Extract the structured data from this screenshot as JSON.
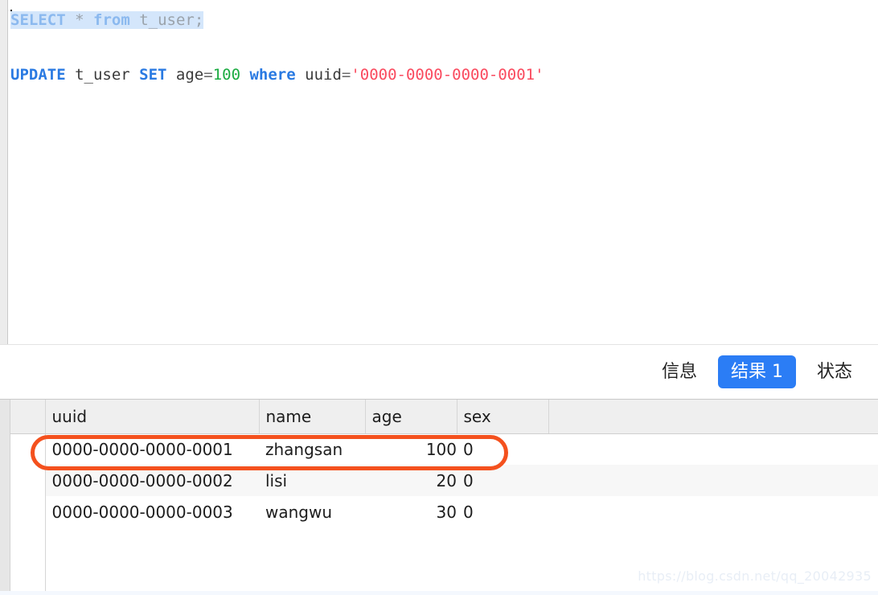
{
  "editor": {
    "lines": [
      {
        "selected": true,
        "tokens": [
          {
            "text": "SELECT",
            "type": "keyword-dim"
          },
          {
            "text": " ",
            "type": "plain-dim"
          },
          {
            "text": "*",
            "type": "operator-dim"
          },
          {
            "text": " ",
            "type": "plain-dim"
          },
          {
            "text": "from",
            "type": "keyword-dim"
          },
          {
            "text": " t_user;",
            "type": "plain-dim"
          }
        ],
        "raw": "SELECT * from t_user;"
      },
      {
        "selected": false,
        "tokens": [],
        "raw": ""
      },
      {
        "selected": false,
        "tokens": [
          {
            "text": "UPDATE",
            "type": "keyword"
          },
          {
            "text": " t_user ",
            "type": "plain"
          },
          {
            "text": "SET",
            "type": "keyword"
          },
          {
            "text": " age",
            "type": "plain"
          },
          {
            "text": "=",
            "type": "operator"
          },
          {
            "text": "100",
            "type": "number"
          },
          {
            "text": " ",
            "type": "plain"
          },
          {
            "text": "where",
            "type": "keyword"
          },
          {
            "text": " uuid",
            "type": "plain"
          },
          {
            "text": "=",
            "type": "operator"
          },
          {
            "text": "'0000-0000-0000-0001'",
            "type": "string"
          }
        ],
        "raw": "UPDATE t_user SET age=100 where uuid='0000-0000-0000-0001'"
      }
    ],
    "caret_line": 0
  },
  "tabs": [
    {
      "label": "信息",
      "active": false
    },
    {
      "label": "结果 1",
      "active": true
    },
    {
      "label": "状态",
      "active": false
    }
  ],
  "result_grid": {
    "columns": [
      "uuid",
      "name",
      "age",
      "sex"
    ],
    "rows": [
      {
        "uuid": "0000-0000-0000-0001",
        "name": "zhangsan",
        "age": "100",
        "sex": "0"
      },
      {
        "uuid": "0000-0000-0000-0002",
        "name": "lisi",
        "age": "20",
        "sex": "0"
      },
      {
        "uuid": "0000-0000-0000-0003",
        "name": "wangwu",
        "age": "30",
        "sex": "0"
      }
    ]
  },
  "annotation": {
    "shape": "rounded-rect",
    "color": "#f4511e",
    "target_row_index": 0
  },
  "watermark": {
    "text": "https://blog.csdn.net/qq_20042935"
  },
  "colors": {
    "accent_blue": "#2b7df5",
    "keyword_blue": "#2a7ae2",
    "string_red": "#fa4a5e",
    "number_green": "#1aab40",
    "selection_blue": "#d4e6fb",
    "annotation_orange": "#f4511e",
    "header_gray": "#efefef"
  }
}
